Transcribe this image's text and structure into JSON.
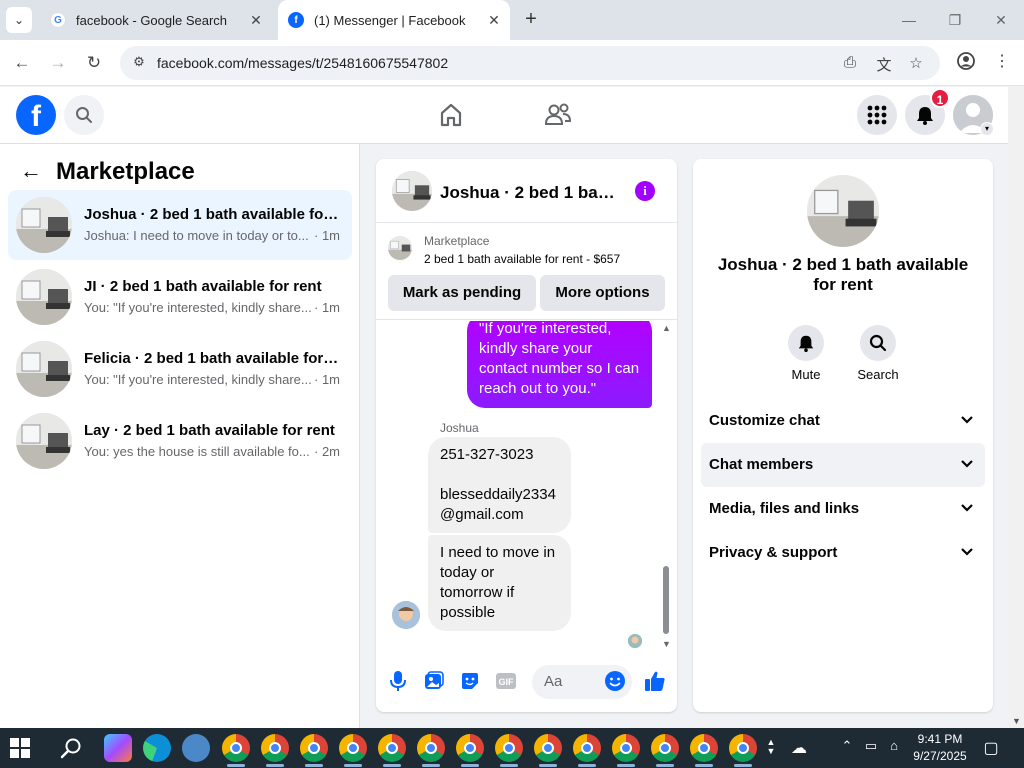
{
  "browser": {
    "tabs": [
      {
        "title": "facebook - Google Search",
        "favicon": "google-icon",
        "active": false
      },
      {
        "title": "(1) Messenger | Facebook",
        "favicon": "facebook-icon",
        "active": true
      }
    ],
    "url": "facebook.com/messages/t/2548160675547802"
  },
  "fb_header": {
    "notification_count": "1"
  },
  "sidebar": {
    "title": "Marketplace",
    "conversations": [
      {
        "name": "Joshua · 2 bed 1 bath available for ...",
        "preview": "Joshua: I need to move in today or to...",
        "time": "· 1m",
        "active": true
      },
      {
        "name": "JI · 2 bed 1 bath available for rent",
        "preview": "You: \"If you're interested, kindly share...",
        "time": "· 1m",
        "active": false
      },
      {
        "name": "Felicia · 2 bed 1 bath available for r...",
        "preview": "You: \"If you're interested, kindly share...",
        "time": "· 1m",
        "active": false
      },
      {
        "name": "Lay · 2 bed 1 bath available for rent",
        "preview": "You: yes the house is still available fo...",
        "time": "· 2m",
        "active": false
      }
    ]
  },
  "chat": {
    "title": "Joshua · 2 bed 1 bath...",
    "listing_source": "Marketplace",
    "listing_title": "2 bed 1 bath available for rent - $657",
    "btn_pending": "Mark as pending",
    "btn_more": "More options",
    "outgoing_message": "\"If you're interested, kindly share your contact number so I can reach out to you.\"",
    "sender_name": "Joshua",
    "incoming_1": "251-327-3023\n\nblesseddaily2334\n@gmail.com",
    "incoming_2": "I need to move in today or tomorrow if possible",
    "composer_placeholder": "Aa"
  },
  "info_panel": {
    "name": "Joshua · 2 bed 1 bath available for rent",
    "actions": [
      {
        "label": "Mute",
        "icon": "bell-icon"
      },
      {
        "label": "Search",
        "icon": "search-icon"
      }
    ],
    "rows": [
      "Customize chat",
      "Chat members",
      "Media, files and links",
      "Privacy & support"
    ]
  },
  "taskbar": {
    "time": "9:41 PM",
    "date": "9/27/2025"
  },
  "colors": {
    "fb_blue": "#0866ff",
    "messenger_purple": "#a200ff",
    "active_conv_bg": "#ebf5ff"
  }
}
